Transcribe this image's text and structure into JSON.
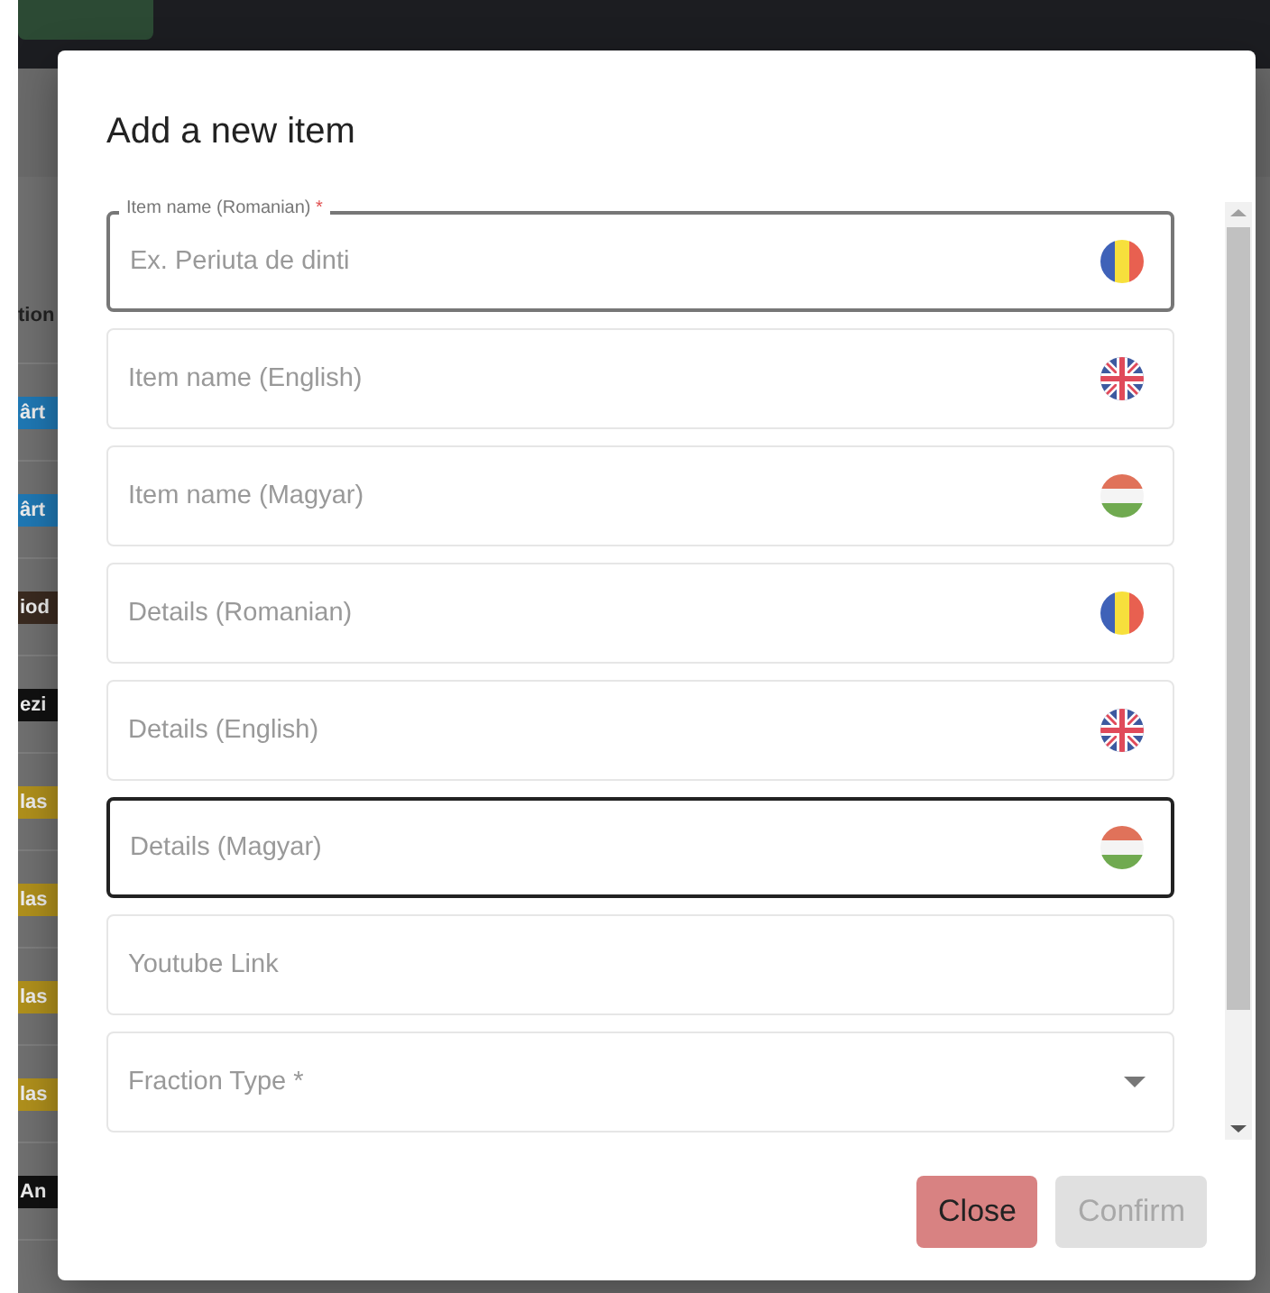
{
  "background": {
    "column_heading": "tion",
    "tags": [
      {
        "text": "ârt",
        "color": "#1f78b4"
      },
      {
        "text": "ârt",
        "color": "#1f78b4"
      },
      {
        "text": "iod",
        "color": "#3a2a20"
      },
      {
        "text": "ezi",
        "color": "#111111"
      },
      {
        "text": "las",
        "color": "#b0901c"
      },
      {
        "text": "las",
        "color": "#b0901c"
      },
      {
        "text": "las",
        "color": "#b0901c"
      },
      {
        "text": "las",
        "color": "#b0901c"
      },
      {
        "text": "An",
        "color": "#111111"
      }
    ]
  },
  "dialog": {
    "title": "Add a new item",
    "fields": [
      {
        "kind": "text",
        "label": "Item name (Romanian)",
        "mark": "*",
        "placeholder": "Ex. Periuta de dinti",
        "flag": {
          "kind": "ro"
        },
        "focused": true,
        "hovered": false
      },
      {
        "kind": "text",
        "placeholder": "Item name (English)",
        "flag": {
          "kind": "gb"
        },
        "focused": false,
        "hovered": false
      },
      {
        "kind": "text",
        "placeholder": "Item name (Magyar)",
        "flag": {
          "kind": "hu"
        },
        "focused": false,
        "hovered": false
      },
      {
        "kind": "text",
        "placeholder": "Details (Romanian)",
        "flag": {
          "kind": "ro"
        },
        "focused": false,
        "hovered": false
      },
      {
        "kind": "text",
        "placeholder": "Details (English)",
        "flag": {
          "kind": "gb"
        },
        "focused": false,
        "hovered": false
      },
      {
        "kind": "text",
        "placeholder": "Details (Magyar)",
        "flag": {
          "kind": "hu"
        },
        "focused": false,
        "hovered": true
      },
      {
        "kind": "text",
        "placeholder": "Youtube Link",
        "focused": false,
        "hovered": false
      },
      {
        "kind": "select",
        "placeholder": "Fraction Type *",
        "focused": false,
        "hovered": false
      }
    ],
    "buttons": [
      {
        "label": "Close",
        "kind": "danger",
        "disabled": false
      },
      {
        "label": "Confirm",
        "kind": "primary",
        "disabled": true
      }
    ]
  }
}
